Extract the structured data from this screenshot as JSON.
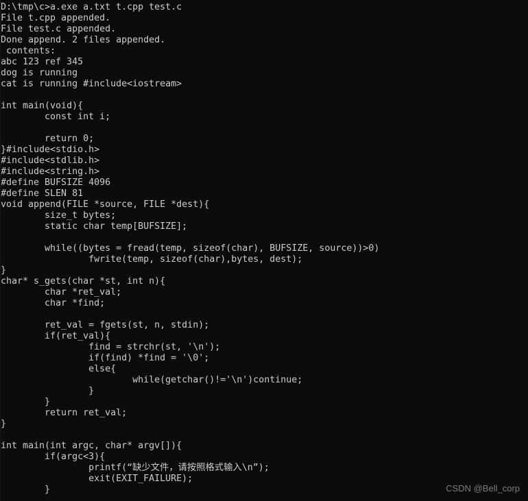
{
  "terminal": {
    "window_title": "D:\\tmp\\c",
    "background_color": "#0c0c0c",
    "foreground_color": "#cccccc",
    "watermark": "CSDN @Bell_corp",
    "watermark_color": "#7e7e82",
    "prompt": "D:\\tmp\\c>",
    "command": "a.exe a.txt t.cpp test.c",
    "lines": [
      "D:\\tmp\\c>a.exe a.txt t.cpp test.c",
      "File t.cpp appended.",
      "File test.c appended.",
      "Done append. 2 files appended.",
      " contents:",
      "abc 123 ref 345",
      "dog is running",
      "cat is running #include<iostream>",
      "",
      "int main(void){",
      "        const int i;",
      "",
      "        return 0;",
      "}#include<stdio.h>",
      "#include<stdlib.h>",
      "#include<string.h>",
      "#define BUFSIZE 4096",
      "#define SLEN 81",
      "void append(FILE *source, FILE *dest){",
      "        size_t bytes;",
      "        static char temp[BUFSIZE];",
      "",
      "        while((bytes = fread(temp, sizeof(char), BUFSIZE, source))>0)",
      "                fwrite(temp, sizeof(char),bytes, dest);",
      "}",
      "char* s_gets(char *st, int n){",
      "        char *ret_val;",
      "        char *find;",
      "",
      "        ret_val = fgets(st, n, stdin);",
      "        if(ret_val){",
      "                find = strchr(st, '\\n');",
      "                if(find) *find = '\\0';",
      "                else{",
      "                        while(getchar()!='\\n')continue;",
      "                }",
      "        }",
      "        return ret_val;",
      "}",
      "",
      "int main(int argc, char* argv[]){",
      "        if(argc<3){",
      "                printf(“缺少文件，请按照格式输入\\n”);",
      "                exit(EXIT_FAILURE);",
      "        }"
    ]
  }
}
